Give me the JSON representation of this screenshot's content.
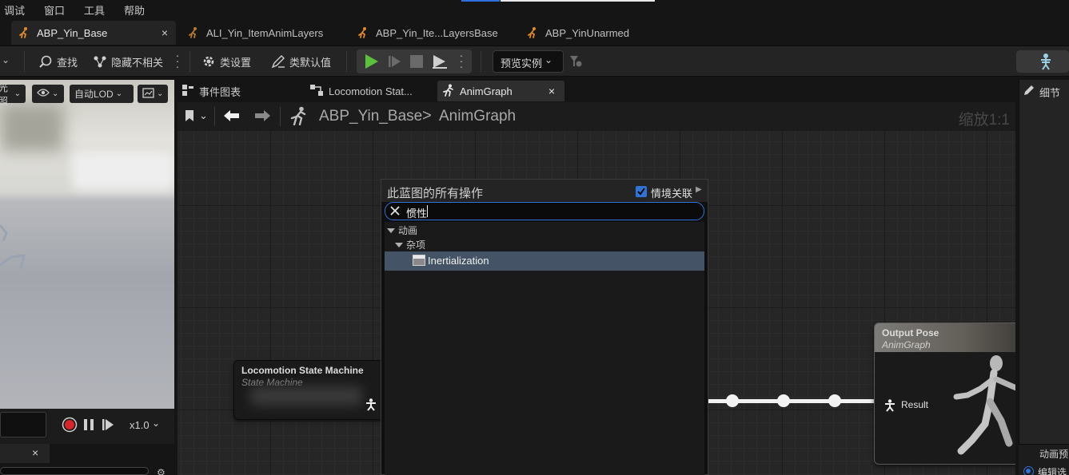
{
  "menu": {
    "items": [
      "调试",
      "窗口",
      "工具",
      "帮助"
    ]
  },
  "asset_tabs": [
    {
      "label": "ABP_Yin_Base",
      "active": true,
      "close": "×"
    },
    {
      "label": "ALI_Yin_ItemAnimLayers",
      "active": false
    },
    {
      "label": "ABP_Yin_Ite...LayersBase",
      "active": false
    },
    {
      "label": "ABP_YinUnarmed",
      "active": false
    }
  ],
  "toolbar": {
    "find": "查找",
    "hide_unrelated": "隐藏不相关",
    "class_settings": "类设置",
    "class_defaults": "类默认值",
    "preview_instance": "预览实例"
  },
  "viewport": {
    "lighting": "光照",
    "lod": "自动LOD",
    "speed": "x1.0",
    "close": "×"
  },
  "graph_tabs": [
    {
      "label": "事件图表",
      "active": false
    },
    {
      "label": "Locomotion Stat...",
      "active": false
    },
    {
      "label": "AnimGraph",
      "active": true,
      "close": "×"
    }
  ],
  "breadcrumb": {
    "root": "ABP_Yin_Base",
    "separator": ">",
    "current": "AnimGraph",
    "zoom": "缩放1:1"
  },
  "nodes": {
    "state_machine": {
      "title": "Locomotion State Machine",
      "subtitle": "State Machine"
    },
    "output_pose": {
      "title": "Output Pose",
      "subtitle": "AnimGraph",
      "pin": "Result"
    }
  },
  "action_menu": {
    "title": "此蓝图的所有操作",
    "context_label": "情境关联",
    "context_checked": true,
    "search_value": "惯性",
    "category": "动画",
    "subcategory": "杂项",
    "result": "Inertialization"
  },
  "right_panel": {
    "details": "细节",
    "anim_preview": "动画预",
    "edit_option": "编辑选"
  },
  "colors": {
    "accent_blue": "#2f73d9",
    "play_green": "#5bc13a",
    "selection": "#445366",
    "record_red": "#d8242b"
  }
}
